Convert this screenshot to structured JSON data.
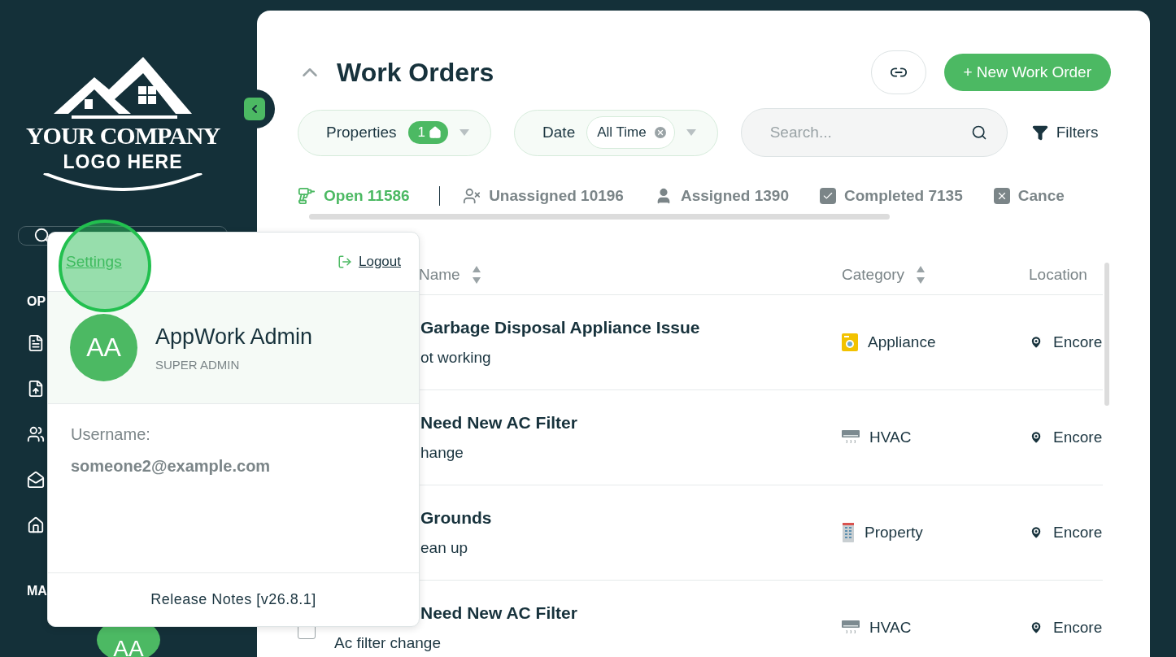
{
  "sidebar": {
    "logo": {
      "line_1": "YOUR COMPANY",
      "line_2": "LOGO HERE"
    },
    "sections": [
      {
        "label": "OP",
        "items": [
          {
            "kind": "document"
          },
          {
            "kind": "upload"
          },
          {
            "kind": "users"
          },
          {
            "kind": "inbox"
          },
          {
            "kind": "home"
          }
        ]
      },
      {
        "label": "MA"
      }
    ],
    "user_avatar": {
      "initials": "AA"
    }
  },
  "popup": {
    "settings_link": "Settings",
    "logout": "Logout",
    "initials": "AA",
    "name": "AppWork Admin",
    "role": "SUPER ADMIN",
    "username_label": "Username:",
    "username": "someone2@example.com",
    "release_notes": "Release Notes [v26.8.1]"
  },
  "header": {
    "title": "Work Orders",
    "new_button": "+ New Work Order"
  },
  "filters": {
    "properties": {
      "label": "Properties",
      "count": "1"
    },
    "date": {
      "label": "Date",
      "value": "All Time"
    },
    "search": {
      "placeholder": "Search..."
    },
    "filters_button": "Filters"
  },
  "status_tabs": [
    {
      "kind": "open",
      "label": "Open 11586",
      "selected": true
    },
    {
      "kind": "unassigned",
      "label": "Unassigned 10196",
      "selected": false
    },
    {
      "kind": "assigned",
      "label": "Assigned 1390",
      "selected": false
    },
    {
      "kind": "completed",
      "label": "Completed 7135",
      "selected": false
    },
    {
      "kind": "cancelled",
      "label": "Cance",
      "selected": false
    }
  ],
  "table": {
    "columns": [
      {
        "label": "Name",
        "sortable": true
      },
      {
        "label": "Category",
        "sortable": true
      },
      {
        "label": "Location",
        "sortable": false
      }
    ],
    "rows": [
      {
        "title": "Garbage Disposal Appliance Issue",
        "description": "ot working",
        "category": {
          "kind": "appliance",
          "label": "Appliance"
        },
        "location": "Encore"
      },
      {
        "title": "Need New AC Filter",
        "description": "hange",
        "category": {
          "kind": "hvac",
          "label": "HVAC"
        },
        "location": "Encore"
      },
      {
        "title": "Grounds",
        "description": "ean up",
        "category": {
          "kind": "property",
          "label": "Property"
        },
        "location": "Encore"
      },
      {
        "title": "Need New AC Filter",
        "description": "Ac filter change",
        "checked": false,
        "category": {
          "kind": "hvac",
          "label": "HVAC"
        },
        "location": "Encore"
      }
    ]
  }
}
